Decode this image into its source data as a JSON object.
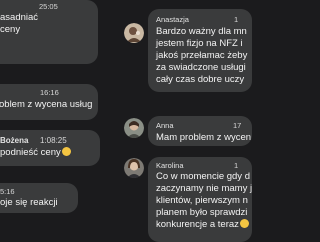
{
  "messages": [
    {
      "time": "25:05",
      "lines": [
        "asadniać",
        "ceny"
      ]
    },
    {
      "time": "16:16",
      "lines": [
        "oblem z wycena usług"
      ]
    },
    {
      "name": "Bożena",
      "time": "1:08:25",
      "lines": [
        "podnieść ceny"
      ]
    },
    {
      "time": "5:16",
      "lines": [
        "oje się reakcji"
      ]
    },
    {
      "name": "Anastazja",
      "time": "1",
      "lines": [
        "Bardzo ważny dla mn",
        "jestem fizjo na NFZ i",
        "jakoś przełamac żeby",
        "za swiadczone usługi",
        "cały czas dobre uczy"
      ]
    },
    {
      "name": "Anna",
      "time": "17",
      "lines": [
        "Mam problem z wycen"
      ]
    },
    {
      "name": "Karolina",
      "time": "1",
      "lines": [
        "Co w momencie gdy d",
        "zaczynamy nie mamy j",
        "klientów, pierwszym n",
        "planem było sprawdzi",
        "konkurencje a teraz"
      ]
    }
  ]
}
